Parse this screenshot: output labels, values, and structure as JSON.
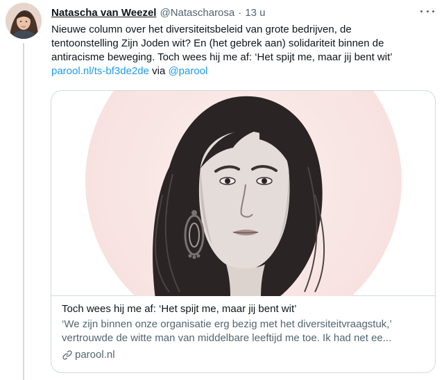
{
  "tweet": {
    "author": {
      "display_name": "Natascha van Weezel",
      "handle": "@Natascharosa",
      "separator": "·",
      "time": "13 u"
    },
    "text": {
      "line1": "Nieuwe column over het diversiteitsbeleid van grote bedrijven, de",
      "line2": "tentoonstelling Zijn Joden wit? En (het gebrek aan) solidariteit binnen de",
      "line3": "antiracisme beweging. Toch wees hij me af: ‘Het spijt me, maar jij bent wit’",
      "link_url": "parool.nl/ts-bf3de2de",
      "via": " via ",
      "mention": "@parool"
    },
    "card": {
      "title": "Toch wees hij me af: ‘Het spijt me, maar jij bent wit’",
      "description_line1": "‘We zijn binnen onze organisatie erg bezig met het diversiteitvraagstuk,’",
      "description_line2": "vertrouwde de witte man van middelbare leeftijd me toe. Ik had net ee...",
      "domain": "parool.nl"
    },
    "icons": {
      "more": "more-horizontal-icon",
      "link": "link-icon"
    },
    "colors": {
      "link": "#1d9bf0",
      "secondary_text": "#536471",
      "border": "#cfd9de",
      "portrait_backdrop": "#f7e4e2"
    }
  }
}
